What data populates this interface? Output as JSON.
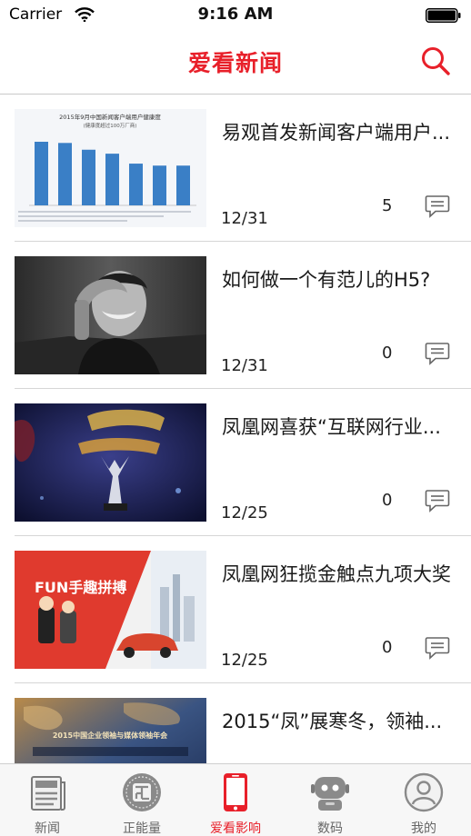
{
  "status_bar": {
    "carrier": "Carrier",
    "time": "9:16 AM"
  },
  "nav": {
    "title": "爱看新闻",
    "search_icon": "search-icon"
  },
  "colors": {
    "accent": "#e8202a",
    "separator": "#d6d6d6",
    "tab_inactive": "#666666"
  },
  "news": [
    {
      "title": "易观首发新闻客户端用户...",
      "date": "12/31",
      "comments": "5",
      "thumb_text": {
        "heading": "2015年9月中国新闻客户端用户健康度",
        "subheading": "(健康度超过100万厂商)"
      },
      "thumb_chart": {
        "type": "bar",
        "values": [
          160,
          157,
          140,
          130,
          105,
          100,
          100
        ]
      }
    },
    {
      "title": "如何做一个有范儿的H5?",
      "date": "12/31",
      "comments": "0"
    },
    {
      "title": "凤凰网喜获“互联网行业...",
      "date": "12/25",
      "comments": "0"
    },
    {
      "title": "凤凰网狂揽金触点九项大奖",
      "date": "12/25",
      "comments": "0",
      "thumb_text": {
        "banner": "FUN手趣拼搏"
      }
    },
    {
      "title": "2015“凤”展寒冬，领袖...",
      "date": "",
      "comments": "",
      "thumb_text": {
        "banner": "2015中国企业领袖与媒体领袖年会"
      }
    }
  ],
  "tabs": [
    {
      "label": "新闻",
      "icon": "newspaper-icon",
      "active": false
    },
    {
      "label": "正能量",
      "icon": "badge-icon",
      "active": false
    },
    {
      "label": "爱看影响",
      "icon": "phone-icon",
      "active": true
    },
    {
      "label": "数码",
      "icon": "robot-icon",
      "active": false
    },
    {
      "label": "我的",
      "icon": "user-icon",
      "active": false
    }
  ]
}
